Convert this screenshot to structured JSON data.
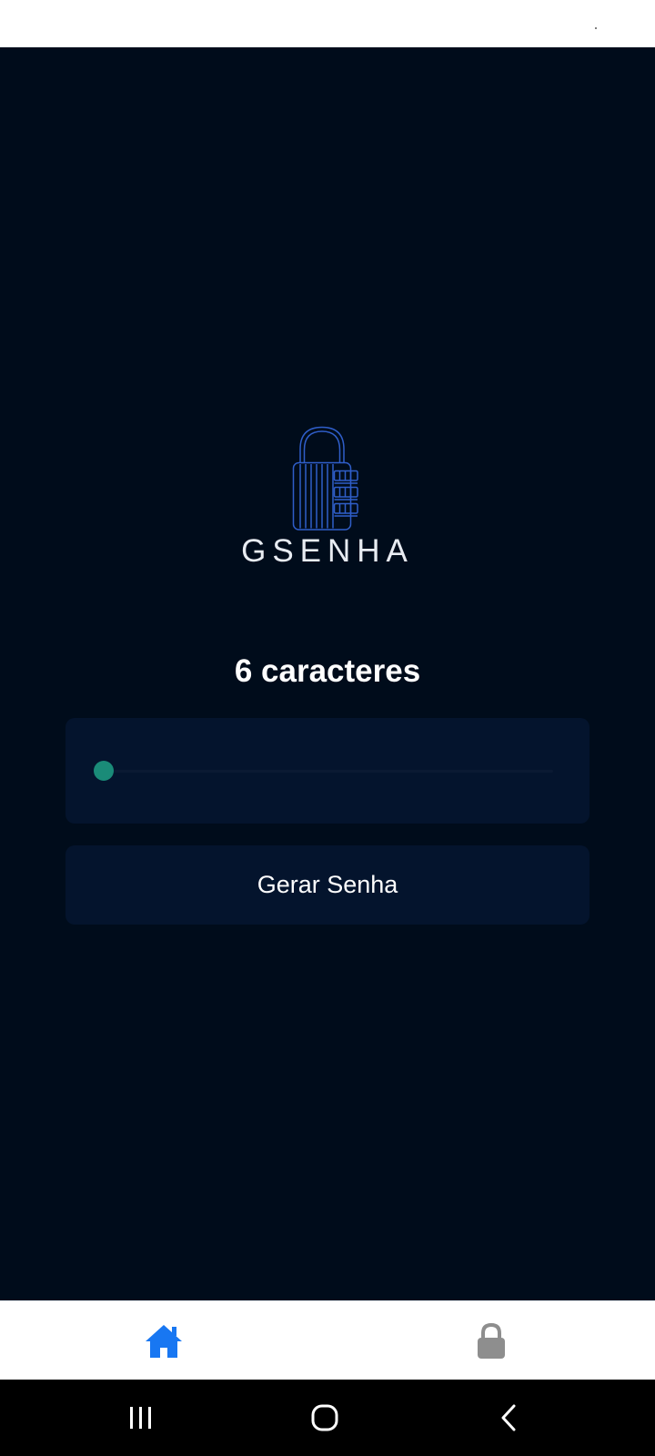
{
  "app": {
    "brand_name": "GSENHA",
    "logo": "combination-padlock-logo"
  },
  "password_length": {
    "label": "6 caracteres",
    "value": 6,
    "slider_fraction": 0
  },
  "actions": {
    "generate_label": "Gerar Senha"
  },
  "tab_bar": {
    "tabs": [
      {
        "icon": "home-icon",
        "active": true
      },
      {
        "icon": "lock-icon",
        "active": false
      }
    ]
  },
  "system_nav": {
    "buttons": [
      "recents-icon",
      "home-circle-icon",
      "back-icon"
    ]
  },
  "colors": {
    "background": "#000c1b",
    "card": "#04142d",
    "accent": "#1a8b78",
    "logo_blue": "#2f5ec9",
    "tab_active": "#1877f2",
    "tab_inactive": "#8e8e8e"
  }
}
